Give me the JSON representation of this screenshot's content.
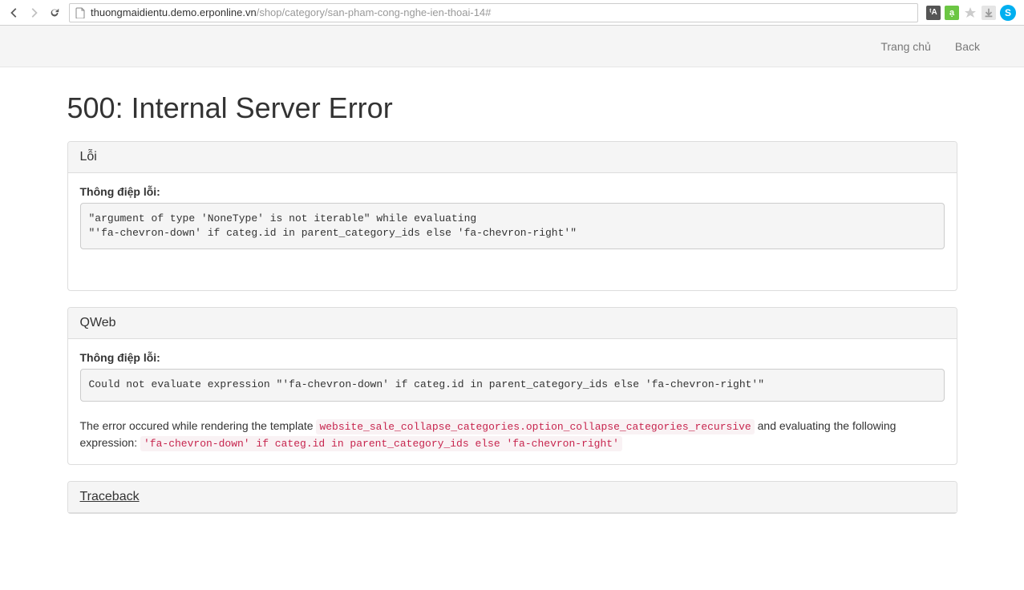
{
  "browser": {
    "url_host": "thuongmaidientu.demo.erponline.vn",
    "url_path": "/shop/category/san-pham-cong-nghe-ien-thoai-14#"
  },
  "nav": {
    "home": "Trang chủ",
    "back": "Back"
  },
  "page": {
    "title": "500: Internal Server Error"
  },
  "panel1": {
    "heading": "Lỗi",
    "msg_label": "Thông điệp lỗi:",
    "msg": "\"argument of type 'NoneType' is not iterable\" while evaluating\n\"'fa-chevron-down' if categ.id in parent_category_ids else 'fa-chevron-right'\""
  },
  "panel2": {
    "heading": "QWeb",
    "msg_label": "Thông điệp lỗi:",
    "msg": "Could not evaluate expression \"'fa-chevron-down' if categ.id in parent_category_ids else 'fa-chevron-right'\"",
    "desc_prefix": "The error occured while rendering the template ",
    "template": "website_sale_collapse_categories.option_collapse_categories_recursive",
    "desc_middle": " and evaluating the following expression: ",
    "expression": "'fa-chevron-down' if categ.id in parent_category_ids else 'fa-chevron-right'"
  },
  "panel3": {
    "heading": "Traceback"
  }
}
